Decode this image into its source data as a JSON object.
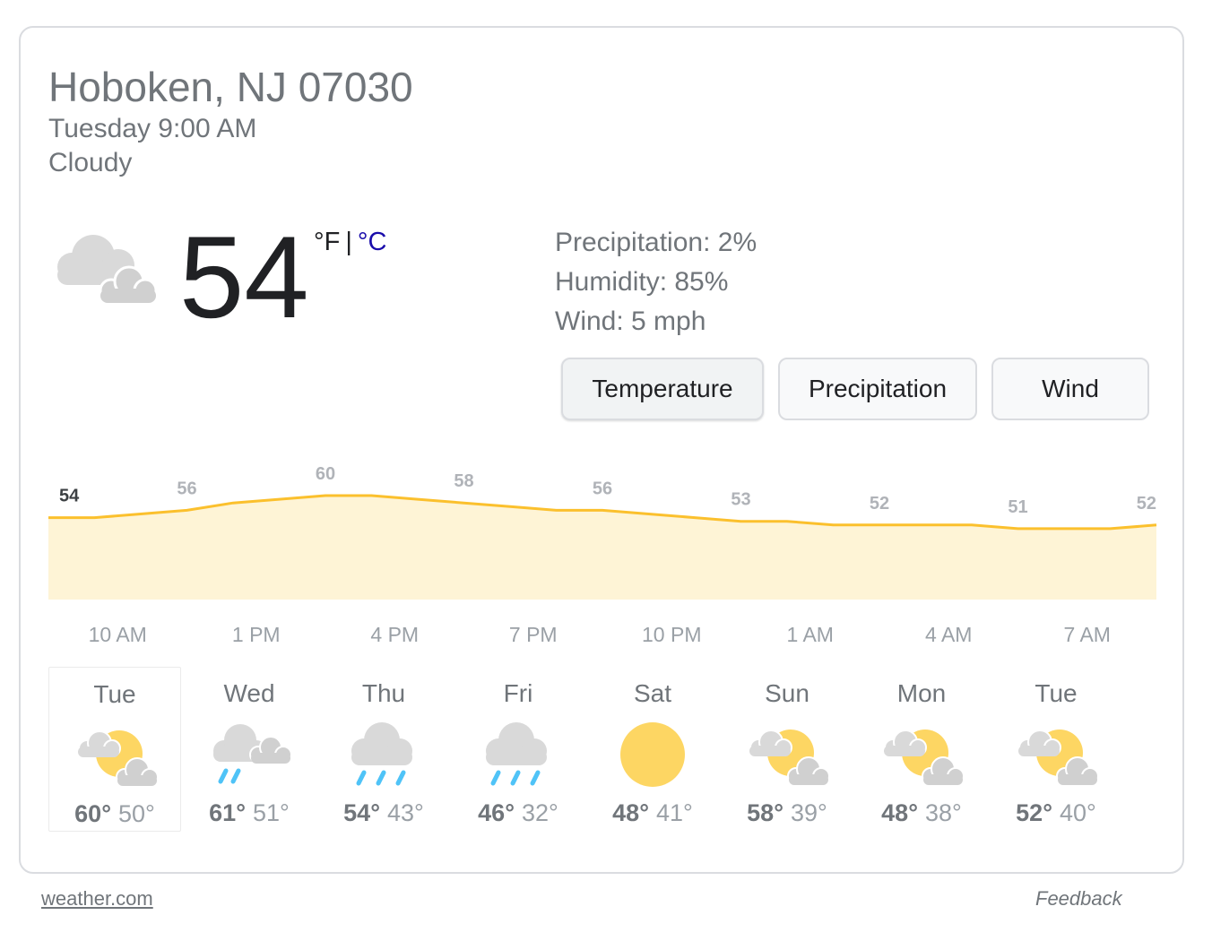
{
  "location": "Hoboken, NJ 07030",
  "datetime": "Tuesday 9:00 AM",
  "condition": "Cloudy",
  "current": {
    "temp": "54",
    "unit_f": "°F",
    "unit_sep": "|",
    "unit_c": "°C",
    "icon": "cloudy-icon"
  },
  "stats": {
    "precipitation": "Precipitation: 2%",
    "humidity": "Humidity: 85%",
    "wind": "Wind: 5 mph"
  },
  "tabs": [
    {
      "label": "Temperature",
      "active": true
    },
    {
      "label": "Precipitation",
      "active": false
    },
    {
      "label": "Wind",
      "active": false
    }
  ],
  "colors": {
    "line": "#fbc02d",
    "fill": "#fef4d6",
    "link": "#1a0dab",
    "text": "#70757a",
    "dark": "#202124"
  },
  "chart_data": {
    "type": "area",
    "title": "",
    "xlabel": "",
    "ylabel": "",
    "ylim": [
      0,
      60
    ],
    "x": [
      "9 AM",
      "10 AM",
      "11 AM",
      "12 PM",
      "1 PM",
      "2 PM",
      "3 PM",
      "4 PM",
      "5 PM",
      "6 PM",
      "7 PM",
      "8 PM",
      "9 PM",
      "10 PM",
      "11 PM",
      "12 AM",
      "1 AM",
      "2 AM",
      "3 AM",
      "4 AM",
      "5 AM",
      "6 AM",
      "7 AM",
      "8 AM",
      "9 AM"
    ],
    "values": [
      54,
      54,
      55,
      56,
      58,
      59,
      60,
      60,
      59,
      58,
      57,
      56,
      56,
      55,
      54,
      53,
      53,
      52,
      52,
      52,
      52,
      51,
      51,
      51,
      52
    ],
    "labels": [
      {
        "text": "54",
        "index": 0
      },
      {
        "text": "56",
        "index": 3
      },
      {
        "text": "60",
        "index": 6
      },
      {
        "text": "58",
        "index": 9
      },
      {
        "text": "56",
        "index": 12
      },
      {
        "text": "53",
        "index": 15
      },
      {
        "text": "52",
        "index": 18
      },
      {
        "text": "51",
        "index": 21
      },
      {
        "text": "52",
        "index": 24
      }
    ],
    "x_ticks": [
      {
        "text": "10 AM",
        "index": 1.5
      },
      {
        "text": "1 PM",
        "index": 4.5
      },
      {
        "text": "4 PM",
        "index": 7.5
      },
      {
        "text": "7 PM",
        "index": 10.5
      },
      {
        "text": "10 PM",
        "index": 13.5
      },
      {
        "text": "1 AM",
        "index": 16.5
      },
      {
        "text": "4 AM",
        "index": 19.5
      },
      {
        "text": "7 AM",
        "index": 22.5
      }
    ]
  },
  "days": [
    {
      "name": "Tue",
      "icon": "partly-sunny-icon",
      "hi": "60°",
      "lo": "50°",
      "selected": true
    },
    {
      "name": "Wed",
      "icon": "rain-cloud-icon",
      "hi": "61°",
      "lo": "51°",
      "selected": false
    },
    {
      "name": "Thu",
      "icon": "showers-icon",
      "hi": "54°",
      "lo": "43°",
      "selected": false
    },
    {
      "name": "Fri",
      "icon": "showers-icon",
      "hi": "46°",
      "lo": "32°",
      "selected": false
    },
    {
      "name": "Sat",
      "icon": "sun-icon",
      "hi": "48°",
      "lo": "41°",
      "selected": false
    },
    {
      "name": "Sun",
      "icon": "partly-sunny-icon",
      "hi": "58°",
      "lo": "39°",
      "selected": false
    },
    {
      "name": "Mon",
      "icon": "partly-sunny-icon",
      "hi": "48°",
      "lo": "38°",
      "selected": false
    },
    {
      "name": "Tue",
      "icon": "partly-sunny-icon",
      "hi": "52°",
      "lo": "40°",
      "selected": false
    }
  ],
  "footer": {
    "source": "weather.com",
    "feedback": "Feedback"
  }
}
